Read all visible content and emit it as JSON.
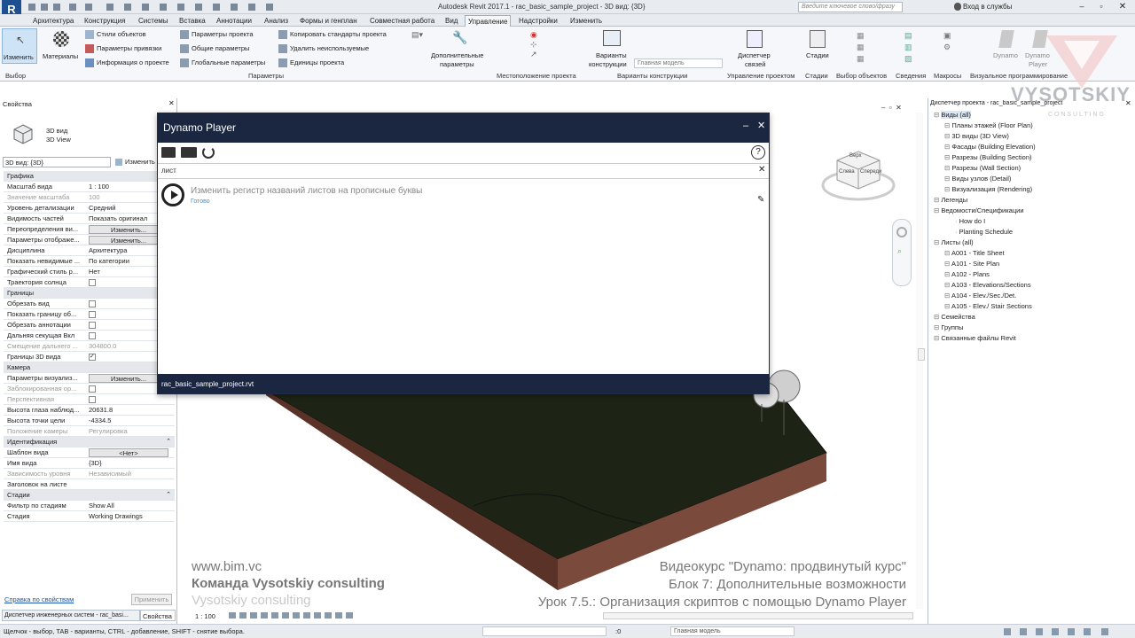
{
  "app": {
    "title": "Autodesk Revit 2017.1 -  rac_basic_sample_project - 3D вид: {3D}",
    "search_placeholder": "Введите ключевое слово/фразу",
    "login": "Вход в службы"
  },
  "ribbon_tabs": [
    "Архитектура",
    "Конструкция",
    "Системы",
    "Вставка",
    "Аннотации",
    "Анализ",
    "Формы и генплан",
    "Совместная работа",
    "Вид",
    "Управление",
    "Надстройки",
    "Изменить"
  ],
  "ribbon": {
    "modify": "Изменить",
    "materials": "Материалы",
    "col1": [
      "Стили объектов",
      "Параметры привязки",
      "Информация о проекте"
    ],
    "col2": [
      "Параметры проекта",
      "Общие параметры",
      "Глобальные  параметры"
    ],
    "col3": [
      "Копировать стандарты проекта",
      "Удалить неиспользуемые",
      "Единицы проекта"
    ],
    "extra_params": [
      "Дополнительные",
      "параметры"
    ],
    "design_options": [
      "Варианты",
      "конструкции"
    ],
    "main_model": "Главная модель",
    "dispatcher": [
      "Диспетчер",
      "связей"
    ],
    "phases": "Стадии",
    "dynamo": "Dynamo",
    "dynamo_player": [
      "Dynamo",
      "Player"
    ],
    "groups": [
      "Выбор",
      "Параметры",
      "Местоположение проекта",
      "Варианты конструкции",
      "Управление проектом",
      "Стадии",
      "Выбор объектов",
      "Сведения",
      "Макросы",
      "Визуальное программирование"
    ]
  },
  "properties": {
    "title": "Свойства",
    "type_name": "3D вид",
    "type_sub": "3D View",
    "selector": "3D вид: {3D}",
    "edit_type": "Изменить тип",
    "rows": [
      {
        "k": "Графика",
        "hdr": true
      },
      {
        "k": "Масштаб вида",
        "v": "1 : 100"
      },
      {
        "k": "Значение масштаба",
        "v": "100",
        "grey": true
      },
      {
        "k": "Уровень детализации",
        "v": "Средний"
      },
      {
        "k": "Видимость частей",
        "v": "Показать оригинал"
      },
      {
        "k": "Переопределения ви...",
        "v": "Изменить...",
        "btn": true
      },
      {
        "k": "Параметры отображе...",
        "v": "Изменить...",
        "btn": true
      },
      {
        "k": "Дисциплина",
        "v": "Архитектура"
      },
      {
        "k": "Показать невидимые ...",
        "v": "По категории"
      },
      {
        "k": "Графический стиль р...",
        "v": "Нет"
      },
      {
        "k": "Траектория солнца",
        "chk": true
      },
      {
        "k": "Границы",
        "hdr": true
      },
      {
        "k": "Обрезать вид",
        "chk": true
      },
      {
        "k": "Показать границу об...",
        "chk": true
      },
      {
        "k": "Обрезать аннотации",
        "chk": true
      },
      {
        "k": "Дальняя секущая Вкл",
        "chk": true
      },
      {
        "k": "Смещение дальнего ...",
        "v": "304800.0",
        "grey": true
      },
      {
        "k": "Границы 3D вида",
        "chk": true,
        "checked": true
      },
      {
        "k": "Камера",
        "hdr": true
      },
      {
        "k": "Параметры визуализ...",
        "v": "Изменить...",
        "btn": true
      },
      {
        "k": "Заблокированная ор...",
        "chk": true,
        "grey": true
      },
      {
        "k": "Перспективная",
        "chk": true,
        "grey": true
      },
      {
        "k": "Высота глаза наблюд...",
        "v": "20631.8"
      },
      {
        "k": "Высота точки цели",
        "v": "-4334.5"
      },
      {
        "k": "Положение камеры",
        "v": "Регулировка",
        "grey": true
      },
      {
        "k": "Идентификация",
        "hdr": true
      },
      {
        "k": "Шаблон вида",
        "v": "<Нет>",
        "btn": true
      },
      {
        "k": "Имя вида",
        "v": "{3D}"
      },
      {
        "k": "Зависимость уровня",
        "v": "Независимый",
        "grey": true
      },
      {
        "k": "Заголовок на листе",
        "v": ""
      },
      {
        "k": "Стадии",
        "hdr": true
      },
      {
        "k": "Фильтр по стадиям",
        "v": "Show All"
      },
      {
        "k": "Стадия",
        "v": "Working Drawings"
      }
    ],
    "help_link": "Справка по свойствам",
    "apply": "Применить",
    "tab_system": "Диспетчер инженерных систем - rac_basi...",
    "tab_props": "Свойства"
  },
  "project_browser": {
    "title": "Диспетчер проекта - rac_basic_sample_project",
    "items": [
      {
        "t": "Виды (all)",
        "l": 0,
        "bold": true
      },
      {
        "t": "Планы этажей (Floor Plan)",
        "l": 1
      },
      {
        "t": "3D виды (3D View)",
        "l": 1
      },
      {
        "t": "Фасады (Building Elevation)",
        "l": 1
      },
      {
        "t": "Разрезы (Building Section)",
        "l": 1
      },
      {
        "t": "Разрезы (Wall Section)",
        "l": 1
      },
      {
        "t": "Виды узлов (Detail)",
        "l": 1
      },
      {
        "t": "Визуализация (Rendering)",
        "l": 1
      },
      {
        "t": "Легенды",
        "l": 0
      },
      {
        "t": "Ведомости/Спецификации",
        "l": 0
      },
      {
        "t": "How do I",
        "l": 2
      },
      {
        "t": "Planting Schedule",
        "l": 2
      },
      {
        "t": "Листы (all)",
        "l": 0
      },
      {
        "t": "A001 - Title Sheet",
        "l": 1
      },
      {
        "t": "A101 - Site Plan",
        "l": 1
      },
      {
        "t": "A102 - Plans",
        "l": 1
      },
      {
        "t": "A103 - Elevations/Sections",
        "l": 1
      },
      {
        "t": "A104 - Elev./Sec./Det.",
        "l": 1
      },
      {
        "t": "A105 - Elev./ Stair Sections",
        "l": 1
      },
      {
        "t": "Семейства",
        "l": 0
      },
      {
        "t": "Группы",
        "l": 0
      },
      {
        "t": "Связанные файлы Revit",
        "l": 0
      }
    ]
  },
  "dynamo_player": {
    "title": "Dynamo Player",
    "search_value": "лист",
    "script_name": "Изменить регистр названий листов на прописные буквы",
    "script_status": "Готово",
    "footer": "rac_basic_sample_project.rvt",
    "help": "?"
  },
  "viewcube": {
    "left": "Слева",
    "front": "Спереди",
    "top": "Верх"
  },
  "overlay": {
    "site": "www.bim.vc",
    "team": "Команда Vysotskiy consulting",
    "team2": "Vysotskiy consulting",
    "course": "Видеокурс \"Dynamo: продвинутый курс\"",
    "block": "Блок 7: Дополнительные возможности",
    "lesson": "Урок 7.5.: Организация скриптов с помощью Dynamo Player",
    "brand": "VYSOTSKIY",
    "brand_sub": "C O N S U L T I N G"
  },
  "view_controls": {
    "scale": "1 : 100"
  },
  "status": {
    "hint": "Щелчок - выбор, TAB - варианты, CTRL - добавление, SHIFT - снятие выбора.",
    "coords": ":0",
    "model": "Главная модель"
  },
  "colors": {
    "dynamo_header": "#1b2640",
    "terrain": "#1e2415",
    "soil": "#7a4b3c"
  }
}
